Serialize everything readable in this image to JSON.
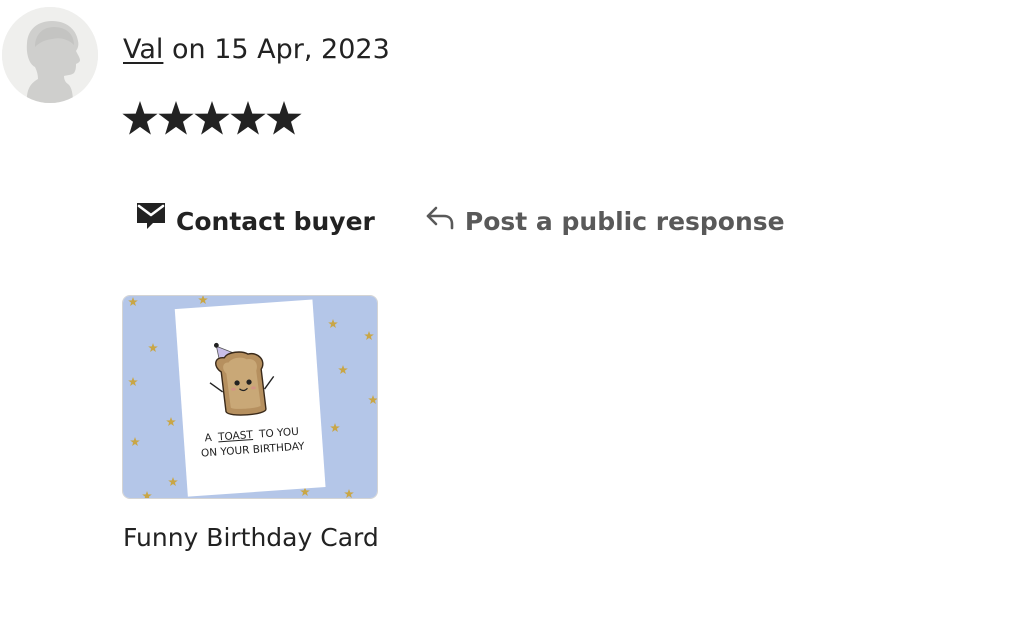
{
  "review": {
    "reviewer_name": "Val",
    "date_text": " on 15 Apr, 2023",
    "rating": 5,
    "rating_max": 5
  },
  "actions": {
    "contact_label": "Contact buyer",
    "respond_label": "Post a public response"
  },
  "item": {
    "title": "Funny Birthday Card",
    "card_line1_a": "A",
    "card_line1_b": "TOAST",
    "card_line1_c": "TO YOU",
    "card_line2": "ON YOUR BIRTHDAY"
  },
  "colors": {
    "text": "#222222",
    "muted_text": "#595959",
    "star": "#222222",
    "thumb_background": "#b4c6e8",
    "confetti_star": "#c9a646"
  },
  "icons": {
    "avatar": "default-avatar-icon",
    "star": "star-icon",
    "contact": "message-icon",
    "respond": "reply-arrow-icon"
  }
}
